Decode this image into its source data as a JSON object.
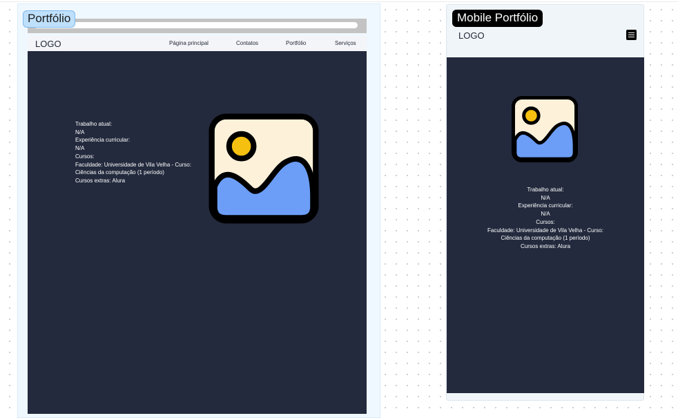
{
  "desktop": {
    "frame_label": "Portfólio",
    "nav": {
      "logo": "LOGO",
      "items": [
        "Página principal",
        "Contatos",
        "Portfólio",
        "Serviços"
      ]
    },
    "content_lines": [
      "Trabalho atual:",
      "N/A",
      "Experiência curricular:",
      "N/A",
      "Cursos:",
      "Faculdade: Universidade de Vila Velha - Curso:",
      "Ciências da computação (1 período)",
      "Cursos extras: Alura"
    ],
    "image_icon": "image-placeholder-icon"
  },
  "mobile": {
    "frame_label": "Mobile Portfólio",
    "logo": "LOGO",
    "menu_icon": "hamburger-menu-icon",
    "image_icon": "image-placeholder-icon",
    "content_lines": [
      "Trabalho atual:",
      "N/A",
      "Experiência curricular:",
      "N/A",
      "Cursos:",
      "Faculdade: Universidade de Vila Velha - Curso:",
      "Ciências da computação (1 período)",
      "Cursos extras: Alura"
    ]
  },
  "colors": {
    "page_background": "#232a3d",
    "nav_background": "#f3f5f8",
    "image_sky": "#fdf1da",
    "image_sun": "#f5c010",
    "image_hill": "#6c9ef8",
    "desktop_label_bg": "#bfe0fb",
    "mobile_label_bg": "#000000"
  }
}
